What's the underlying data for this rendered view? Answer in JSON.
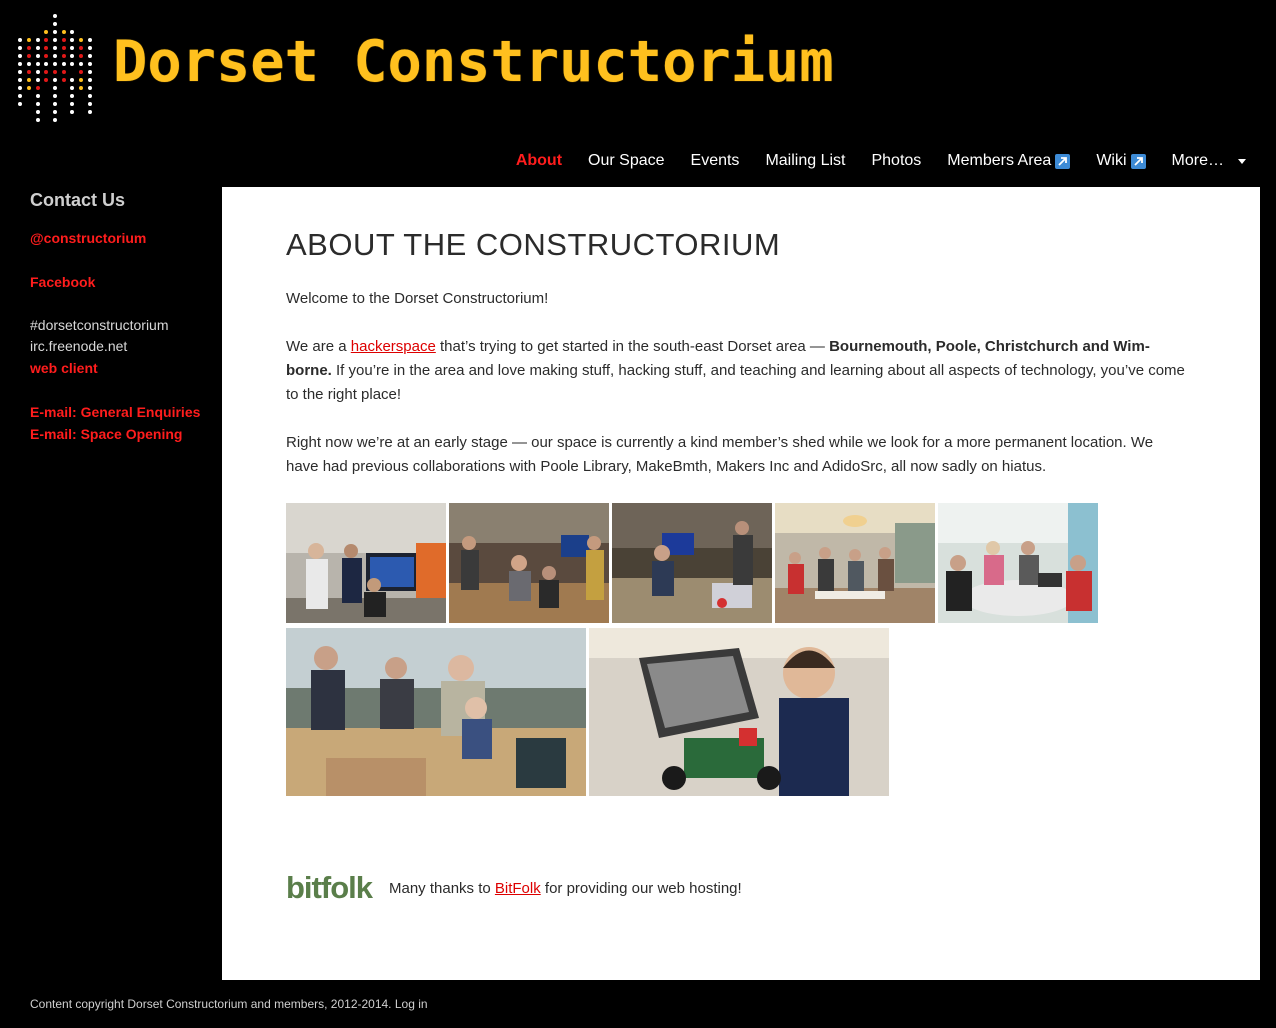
{
  "header": {
    "site_title": "Dorset Constructorium",
    "title_color": "#ffc01e"
  },
  "nav": {
    "items": [
      {
        "label": "About",
        "active": true
      },
      {
        "label": "Our Space"
      },
      {
        "label": "Events"
      },
      {
        "label": "Mailing List"
      },
      {
        "label": "Photos"
      },
      {
        "label": "Members Area",
        "external": true
      },
      {
        "label": "Wiki",
        "external": true
      },
      {
        "label": "More…",
        "dropdown": true
      }
    ],
    "active_color": "#ff1d1d"
  },
  "sidebar": {
    "heading": "Contact Us",
    "twitter": "@constructorium",
    "facebook": "Facebook",
    "irc_channel": "#dorsetconstructorium",
    "irc_server": "irc.freenode.net",
    "web_client": "web client",
    "email_general": "E-mail: General Enquiries",
    "email_space": "E-mail: Space Opening"
  },
  "main": {
    "title": "ABOUT THE CONSTRUCTORIUM",
    "welcome": "Welcome to the Dorset Constructorium!",
    "p2_before": "We are a ",
    "p2_link": "hackerspace",
    "p2_mid": " that’s trying to get started in the south-east Dorset area — ",
    "p2_bold": "Bournemouth, Poole, Christchurch and Wim­borne.",
    "p2_after": " If you’re in the area and love making stuff, hacking stuff, and teaching and learning about all aspects of technology, you’ve come to the right place!",
    "p3": "Right now we’re at an early stage — our space is currently a kind member’s shed while we look for a more permanent location. We have had previous collaborations with Poole Library, MakeBmth, Makers Inc and AdidoSrc, all now sadly on hiatus.",
    "photos": [
      {
        "name": "photo-people-at-screen"
      },
      {
        "name": "photo-workbench-group"
      },
      {
        "name": "photo-soldering-table"
      },
      {
        "name": "photo-cafe-meetup"
      },
      {
        "name": "photo-round-table-laptops"
      },
      {
        "name": "photo-meeting-room-kids"
      },
      {
        "name": "photo-child-robot-car"
      }
    ],
    "hosting_logo": "bitfolk",
    "hosting_before": "Many thanks to ",
    "hosting_link": "BitFolk",
    "hosting_after": " for providing our web hosting!"
  },
  "footer": {
    "copyright": "Content copyright Dorset Constructorium and members, 2012-2014.",
    "login": "Log in"
  }
}
